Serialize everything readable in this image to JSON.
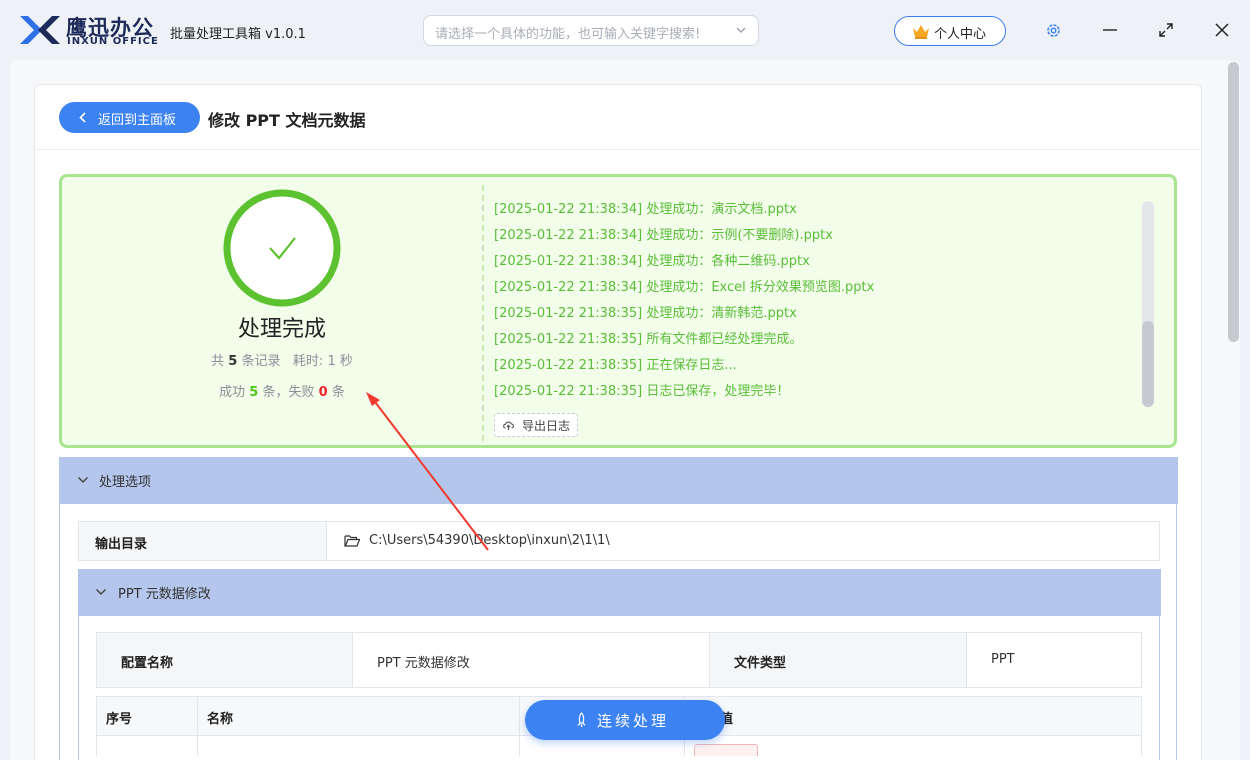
{
  "app": {
    "logo_cn": "鹰迅办公",
    "logo_en": "INXUN OFFICE",
    "title": "批量处理工具箱 v1.0.1",
    "search_placeholder": "请选择一个具体的功能，也可输入关键字搜索!",
    "user_center": "个人中心"
  },
  "header": {
    "back_label": "返回到主面板",
    "page_title": "修改 PPT 文档元数据"
  },
  "result": {
    "status_title": "处理完成",
    "total_prefix": "共",
    "total_count": "5",
    "total_suffix": "条记录",
    "time_prefix": "耗时:",
    "time_value": "1 秒",
    "success_prefix": "成功",
    "success_count": "5",
    "success_suffix": "条，失败",
    "fail_count": "0",
    "fail_suffix": "条",
    "log_lines": [
      "[2025-01-22 21:38:34] 处理成功：演示文档.pptx",
      "[2025-01-22 21:38:34] 处理成功：示例(不要删除).pptx",
      "[2025-01-22 21:38:34] 处理成功：各种二维码.pptx",
      "[2025-01-22 21:38:34] 处理成功：Excel 拆分效果预览图.pptx",
      "[2025-01-22 21:38:35] 处理成功：清新韩范.pptx",
      "[2025-01-22 21:38:35] 所有文件都已经处理完成。",
      "[2025-01-22 21:38:35] 正在保存日志...",
      "[2025-01-22 21:38:35] 日志已保存，处理完毕！"
    ],
    "export_label": "导出日志"
  },
  "options": {
    "title": "处理选项",
    "output_dir_label": "输出目录",
    "output_dir_path": "C:\\Users\\54390\\Desktop\\inxun\\2\\1\\1\\",
    "sub_title": "PPT 元数据修改",
    "config_name_label": "配置名称",
    "config_name_value": "PPT 元数据修改",
    "file_type_label": "文件类型",
    "file_type_value": "PPT",
    "table_headers": [
      "序号",
      "名称",
      "",
      "数据值"
    ]
  },
  "fab_label": "连续处理",
  "colors": {
    "accent": "#3d82f2",
    "success": "#52c41a",
    "fail": "#f5222d",
    "panel_header": "#b4c6ec",
    "result_bg": "#f2fdea"
  }
}
